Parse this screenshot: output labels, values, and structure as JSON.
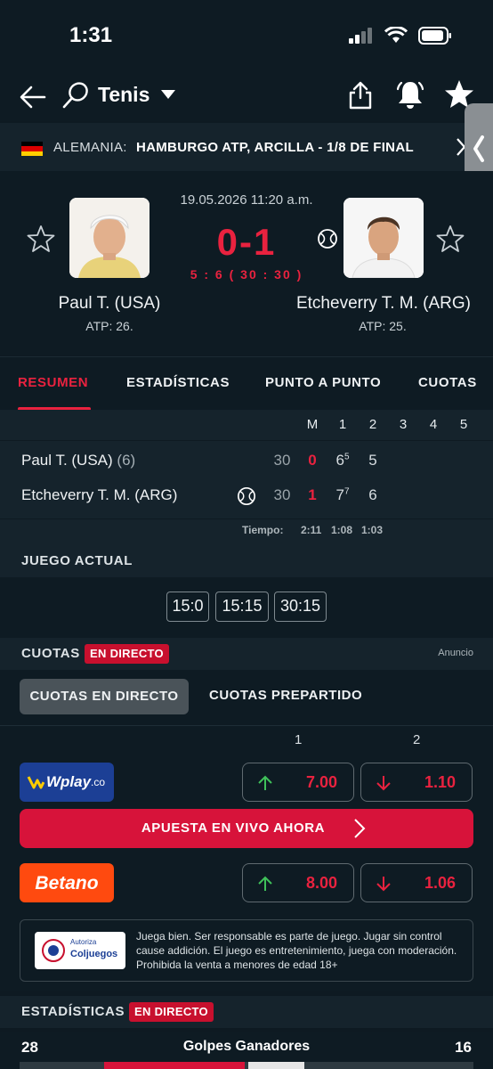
{
  "status_bar": {
    "time": "1:31"
  },
  "header": {
    "sport": "Tenis"
  },
  "tournament": {
    "country": "ALEMANIA:",
    "name": "HAMBURGO ATP, ARCILLA - 1/8 DE FINAL"
  },
  "match": {
    "datetime": "19.05.2026 11:20 a.m.",
    "score": "0-1",
    "game_score": "5 : 6 ( 30 : 30 )",
    "home": {
      "name": "Paul T. (USA)",
      "rank": "ATP: 26."
    },
    "away": {
      "name": "Etcheverry T. M. (ARG)",
      "rank": "ATP: 25."
    }
  },
  "tabs": [
    "RESUMEN",
    "ESTADÍSTICAS",
    "PUNTO A PUNTO",
    "CUOTAS"
  ],
  "scoreboard": {
    "headers": [
      "M",
      "1",
      "2",
      "3",
      "4",
      "5"
    ],
    "rows": [
      {
        "name": "Paul T. (USA)",
        "seed": "(6)",
        "points": "30",
        "sets_won": "0",
        "set1": "6",
        "set1_tb": "5",
        "set2": "5"
      },
      {
        "name": "Etcheverry T. M. (ARG)",
        "seed": "",
        "points": "30",
        "sets_won": "1",
        "set1": "7",
        "set1_tb": "7",
        "set2": "6"
      }
    ],
    "time_label": "Tiempo:",
    "times": [
      "2:11",
      "1:08",
      "1:03"
    ]
  },
  "current_game": {
    "title": "JUEGO ACTUAL",
    "points": [
      "15:0",
      "15:15",
      "30:15"
    ]
  },
  "odds": {
    "title": "CUOTAS",
    "live_badge": "EN DIRECTO",
    "ad_label": "Anuncio",
    "tab_live": "CUOTAS EN DIRECTO",
    "tab_pre": "CUOTAS PREPARTIDO",
    "col1": "1",
    "col2": "2",
    "bookmakers": [
      {
        "name": "Wplay.co",
        "logo_text": "Wplay",
        "logo_suffix": ".co",
        "odd1": "7.00",
        "odd2": "1.10",
        "color": "#1c3f95"
      },
      {
        "name": "Betano",
        "logo_text": "Betano",
        "odd1": "8.00",
        "odd2": "1.06",
        "color": "#ff4a0f"
      }
    ],
    "cta": "APUESTA EN VIVO AHORA"
  },
  "disclaimer": {
    "logo_top": "Autoriza",
    "logo_main": "Coljuegos",
    "text": "Juega bien. Ser responsable es parte de juego. Jugar sin control cause addición. El juego es entretenimiento, juega con moderación. Prohibida la venta a menores de edad 18+"
  },
  "stats": {
    "title": "ESTADÍSTICAS",
    "live_badge": "EN DIRECTO",
    "rows": [
      {
        "label": "Golpes Ganadores",
        "home": "28",
        "away": "16"
      }
    ]
  },
  "colors": {
    "accent": "#e9223f",
    "background": "#0e1a22",
    "panel": "#15232c"
  }
}
